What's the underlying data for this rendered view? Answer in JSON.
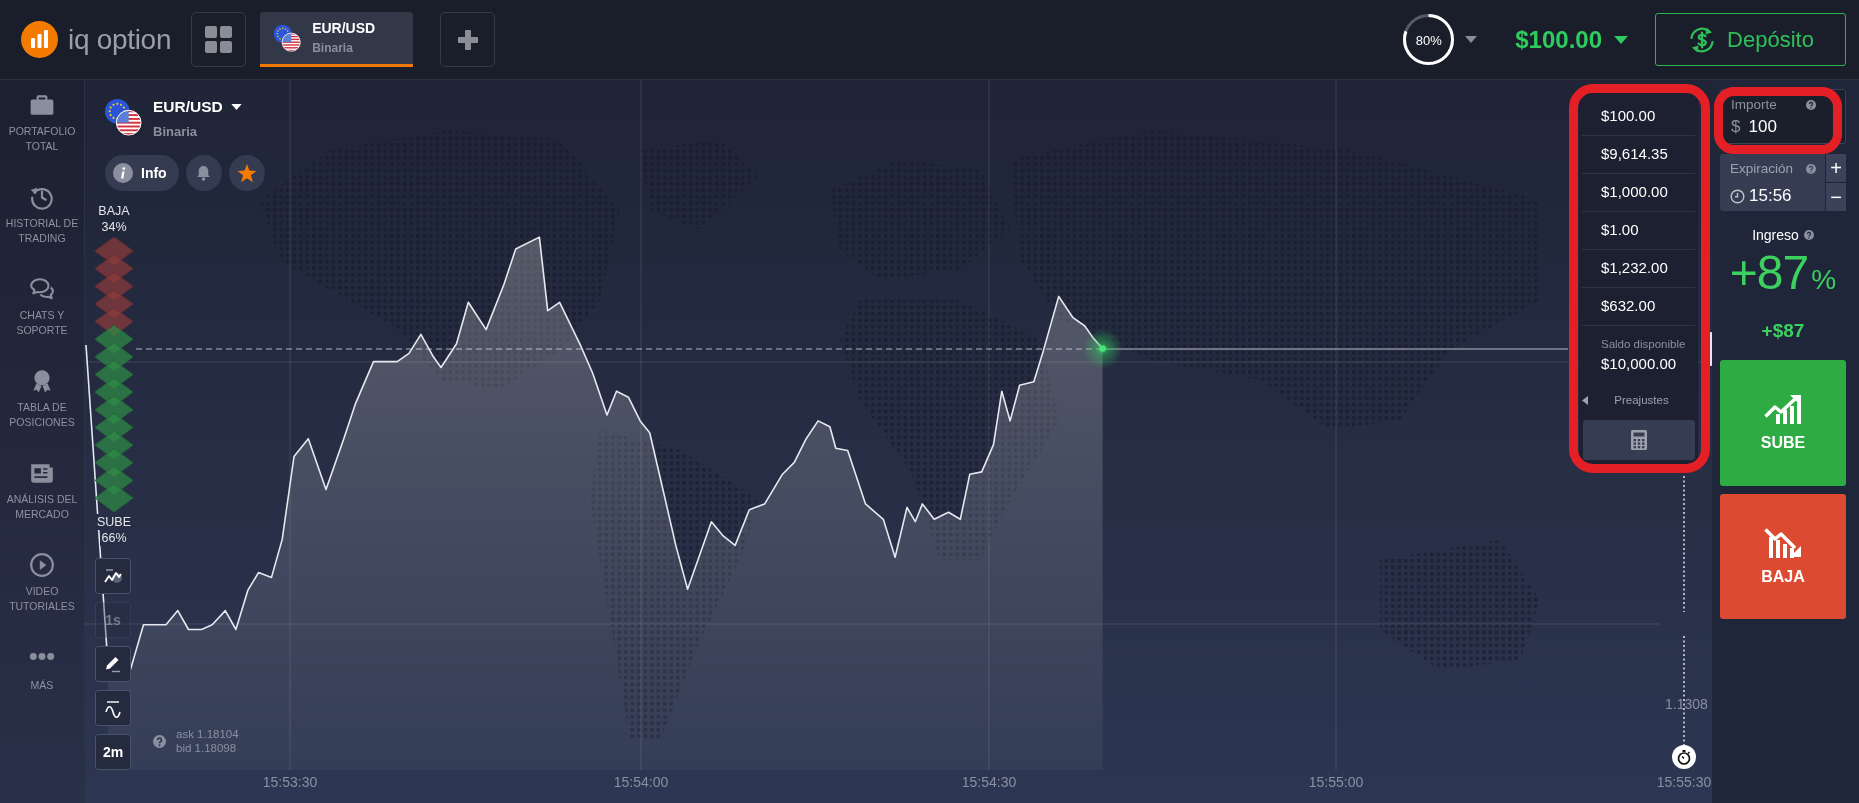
{
  "header": {
    "logo": "iq option",
    "tabs": [
      {
        "symbol": "EUR/USD",
        "type": "Binaria",
        "selected": true
      }
    ],
    "profitability": {
      "label": "80%",
      "level": 0.8
    },
    "balance": "$100.00",
    "deposit_button": "Depósito"
  },
  "sidebar": {
    "items": [
      {
        "label": "PORTAFOLIO\nTOTAL"
      },
      {
        "label": "HISTORIAL DE\nTRADING"
      },
      {
        "label": "CHATS Y\nSOPORTE"
      },
      {
        "label": "TABLA DE\nPOSICIONES"
      },
      {
        "label": "ANÁLISIS DEL\nMERCADO"
      },
      {
        "label": "VIDEO\nTUTORIALES"
      },
      {
        "label": "MÁS"
      }
    ]
  },
  "asset": {
    "symbol": "EUR/USD",
    "type": "Binaria",
    "info_button": "Info",
    "favorite": true
  },
  "sentiment": {
    "down_label": "BAJA",
    "down_percent": "34%",
    "up_label": "SUBE",
    "up_percent": "66%",
    "level": 0.34
  },
  "chart_tools": [
    {
      "disabled": false
    },
    {
      "label": "1s",
      "disabled": true
    },
    {
      "disabled": false
    },
    {
      "disabled": false
    },
    {
      "label": "2m",
      "disabled": false
    }
  ],
  "quote": {
    "ask": "ask 1.18104",
    "bid": "bid 1.18098"
  },
  "chart": {
    "price_label": "1.1308",
    "time_labels": [
      "15:53:30",
      "15:54:00",
      "15:54:30",
      "15:55:00",
      "15:55:30"
    ]
  },
  "presets": {
    "highlighted": true,
    "items": [
      "$100.00",
      "$9,614.35",
      "$1,000.00",
      "$1.00",
      "$1,232.00",
      "$632.00"
    ],
    "balance_label": "Saldo disponible",
    "balance": "$10,000.00",
    "title": "Preajustes"
  },
  "trade_panel": {
    "amount": {
      "label": "Importe",
      "currency": "$",
      "value": "100",
      "highlighted": true
    },
    "expiration": {
      "label": "Expiración",
      "value": "15:56",
      "steppers": [
        "+",
        "−"
      ]
    },
    "payout": {
      "label": "Ingreso",
      "percent": "+87",
      "unit": "%",
      "amount": "+$87"
    },
    "buttons": [
      {
        "kind": "up",
        "label": "SUBE"
      },
      {
        "kind": "down",
        "label": "BAJA"
      }
    ]
  }
}
